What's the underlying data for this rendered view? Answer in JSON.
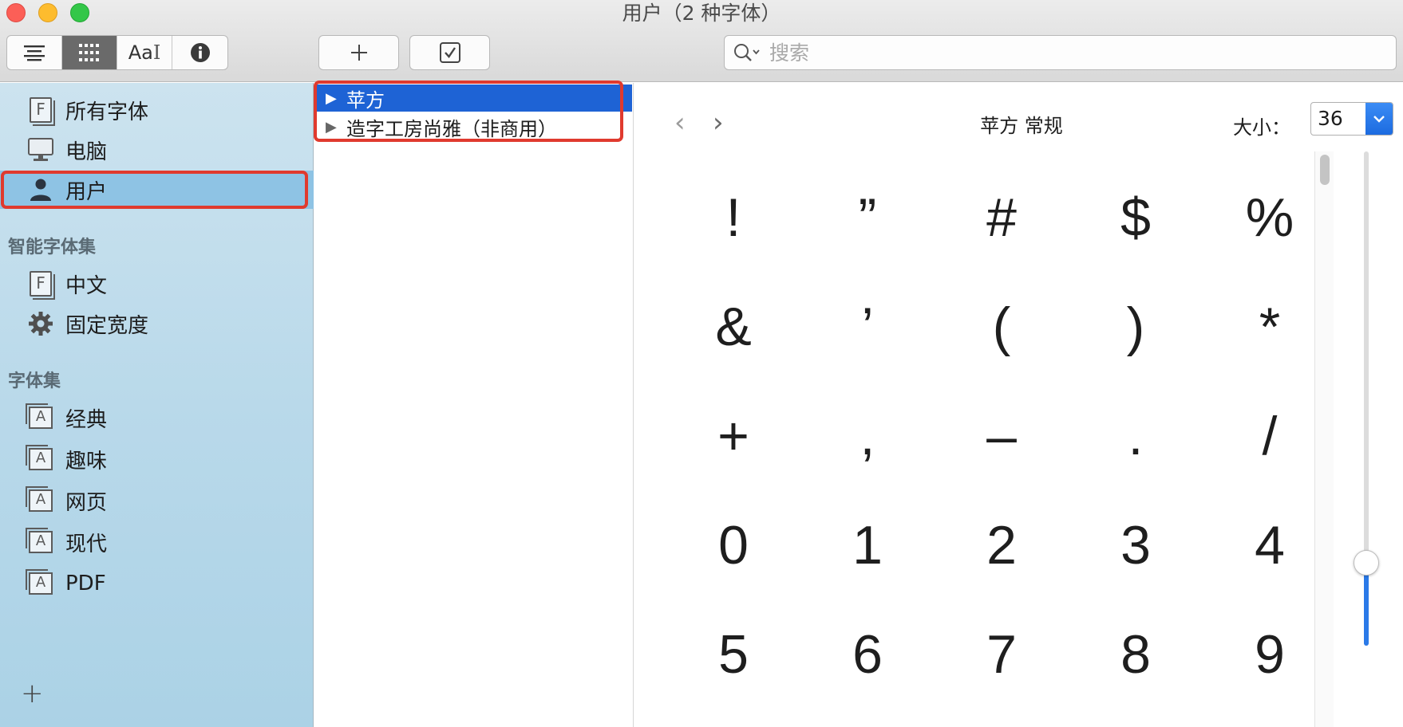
{
  "window": {
    "title": "用户（2 种字体）"
  },
  "toolbar": {
    "view_buttons": [
      {
        "icon": "list-view-icon"
      },
      {
        "icon": "grid-view-icon",
        "active": true
      },
      {
        "label": "Aa",
        "icon": "sample-text-icon"
      },
      {
        "icon": "info-icon"
      }
    ],
    "add_icon": "plus-icon",
    "validate_icon": "checkbox-icon",
    "search_placeholder": "搜索"
  },
  "sidebar": {
    "library_items": [
      {
        "label": "所有字体",
        "icon": "font-library-icon"
      },
      {
        "label": "电脑",
        "icon": "computer-icon"
      },
      {
        "label": "用户",
        "icon": "user-icon",
        "selected": true
      }
    ],
    "smart_section": "智能字体集",
    "smart_items": [
      {
        "label": "中文",
        "icon": "font-library-icon"
      },
      {
        "label": "固定宽度",
        "icon": "gear-icon"
      }
    ],
    "collections_section": "字体集",
    "collection_items": [
      {
        "label": "经典",
        "icon": "collection-icon"
      },
      {
        "label": "趣味",
        "icon": "collection-icon"
      },
      {
        "label": "网页",
        "icon": "collection-icon"
      },
      {
        "label": "现代",
        "icon": "collection-icon"
      },
      {
        "label": "PDF",
        "icon": "collection-icon"
      }
    ],
    "add_label": "+"
  },
  "font_list": {
    "families": [
      {
        "name": "苹方",
        "selected": true
      },
      {
        "name": "造字工房尚雅（非商用）",
        "selected": false
      }
    ]
  },
  "preview": {
    "title": "苹方 常规",
    "size_label": "大小：",
    "size_value": "36",
    "glyphs": [
      "!",
      "”",
      "#",
      "$",
      "%",
      "&",
      "’",
      "(",
      ")",
      "*",
      "+",
      ",",
      "–",
      ".",
      "/",
      "0",
      "1",
      "2",
      "3",
      "4",
      "5",
      "6",
      "7",
      "8",
      "9"
    ]
  },
  "colors": {
    "selection_blue": "#1e63d5",
    "highlight_red": "#e03a2e",
    "sidebar_selected": "#8ec3e4"
  }
}
